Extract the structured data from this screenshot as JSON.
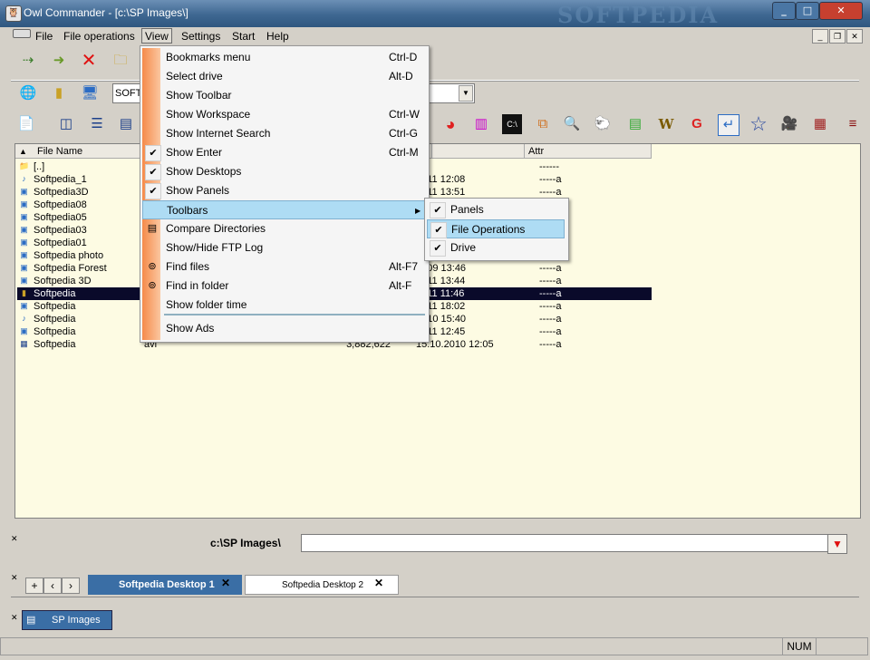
{
  "window": {
    "title": "Owl Commander - [c:\\SP Images\\]",
    "watermark": "SOFTPEDIA"
  },
  "menubar": [
    {
      "label": "File"
    },
    {
      "label": "File operations"
    },
    {
      "label": "View"
    },
    {
      "label": "Settings"
    },
    {
      "label": "Start"
    },
    {
      "label": "Help"
    }
  ],
  "drive_combo": {
    "value": "SOFT"
  },
  "file_list": {
    "headers": {
      "name": "File Name",
      "attr": "Attr"
    },
    "rows": [
      {
        "name": "[..]",
        "ext": "",
        "size": "",
        "date": "",
        "attr": "------",
        "icon": "folder-up-icon"
      },
      {
        "name": "Softpedia_1",
        "ext": "",
        "size": "",
        "date": "2011 12:08",
        "attr": "-----a",
        "icon": "music-file-icon"
      },
      {
        "name": "Softpedia3D",
        "ext": "",
        "size": "",
        "date": "2011 13:51",
        "attr": "-----a",
        "icon": "image-file-icon"
      },
      {
        "name": "Softpedia08",
        "ext": "",
        "size": "",
        "date": "",
        "attr": "",
        "icon": "image-file-icon"
      },
      {
        "name": "Softpedia05",
        "ext": "",
        "size": "",
        "date": "",
        "attr": "",
        "icon": "image-file-icon"
      },
      {
        "name": "Softpedia03",
        "ext": "",
        "size": "",
        "date": "",
        "attr": "",
        "icon": "image-file-icon"
      },
      {
        "name": "Softpedia01",
        "ext": "",
        "size": "",
        "date": "",
        "attr": "",
        "icon": "image-file-icon"
      },
      {
        "name": "Softpedia photo",
        "ext": "",
        "size": "",
        "date": "",
        "attr": "",
        "icon": "image-file-icon"
      },
      {
        "name": "Softpedia Forest",
        "ext": "",
        "size": "",
        "date": "2009 13:46",
        "attr": "-----a",
        "icon": "image-file-icon"
      },
      {
        "name": "Softpedia 3D",
        "ext": "",
        "size": "",
        "date": "2011 13:44",
        "attr": "-----a",
        "icon": "image-file-icon"
      },
      {
        "name": "Softpedia",
        "ext": "",
        "size": "",
        "date": "2011 11:46",
        "attr": "-----a",
        "icon": "archive-file-icon",
        "selected": true
      },
      {
        "name": "Softpedia",
        "ext": "",
        "size": "",
        "date": "2011 18:02",
        "attr": "-----a",
        "icon": "image-file-icon"
      },
      {
        "name": "Softpedia",
        "ext": "",
        "size": "",
        "date": "2010 15:40",
        "attr": "-----a",
        "icon": "music-file-icon"
      },
      {
        "name": "Softpedia",
        "ext": "",
        "size": "",
        "date": "2011 12:45",
        "attr": "-----a",
        "icon": "image-file-icon"
      },
      {
        "name": "Softpedia",
        "ext": "avi",
        "size": "3,882,622",
        "date": "15.10.2010 12:05",
        "attr": "-----a",
        "icon": "video-file-icon"
      }
    ]
  },
  "view_menu": [
    {
      "label": "Bookmarks menu",
      "shortcut": "Ctrl-D"
    },
    {
      "label": "Select drive",
      "shortcut": "Alt-D"
    },
    {
      "label": "Show Toolbar",
      "shortcut": ""
    },
    {
      "label": "Show Workspace",
      "shortcut": "Ctrl-W"
    },
    {
      "label": "Show Internet Search",
      "shortcut": "Ctrl-G"
    },
    {
      "label": "Show Enter",
      "shortcut": "Ctrl-M",
      "checked": true
    },
    {
      "label": "Show Desktops",
      "shortcut": "",
      "checked": true
    },
    {
      "label": "Show Panels",
      "shortcut": "",
      "checked": true
    },
    {
      "label": "Toolbars",
      "shortcut": "",
      "submenu": true
    },
    {
      "label": "Compare Directories",
      "shortcut": "",
      "icon": "compare-icon"
    },
    {
      "label": "Show/Hide FTP Log",
      "shortcut": ""
    },
    {
      "label": "Find files",
      "shortcut": "Alt-F7",
      "icon": "binoculars-icon"
    },
    {
      "label": "Find in folder",
      "shortcut": "Alt-F",
      "icon": "binoculars-icon"
    },
    {
      "label": "Show folder time",
      "shortcut": ""
    },
    {
      "label": "Show Ads",
      "shortcut": ""
    }
  ],
  "toolbars_submenu": [
    {
      "label": "Panels",
      "checked": true
    },
    {
      "label": "File Operations",
      "checked": true,
      "highlighted": true
    },
    {
      "label": "Drive",
      "checked": true
    }
  ],
  "command_line": {
    "path": "c:\\SP Images\\",
    "value": ""
  },
  "desktop_tabs": [
    {
      "label": "Softpedia Desktop 1",
      "active": true
    },
    {
      "label": "Softpedia Desktop 2",
      "active": false
    }
  ],
  "taskbar": {
    "item": "SP Images"
  },
  "status": {
    "num": "NUM"
  },
  "colors": {
    "accent": "#3a6ea5",
    "selection": "#0a0a2a",
    "highlight": "#aedcf4",
    "panel_bg": "#fdfbe3"
  }
}
